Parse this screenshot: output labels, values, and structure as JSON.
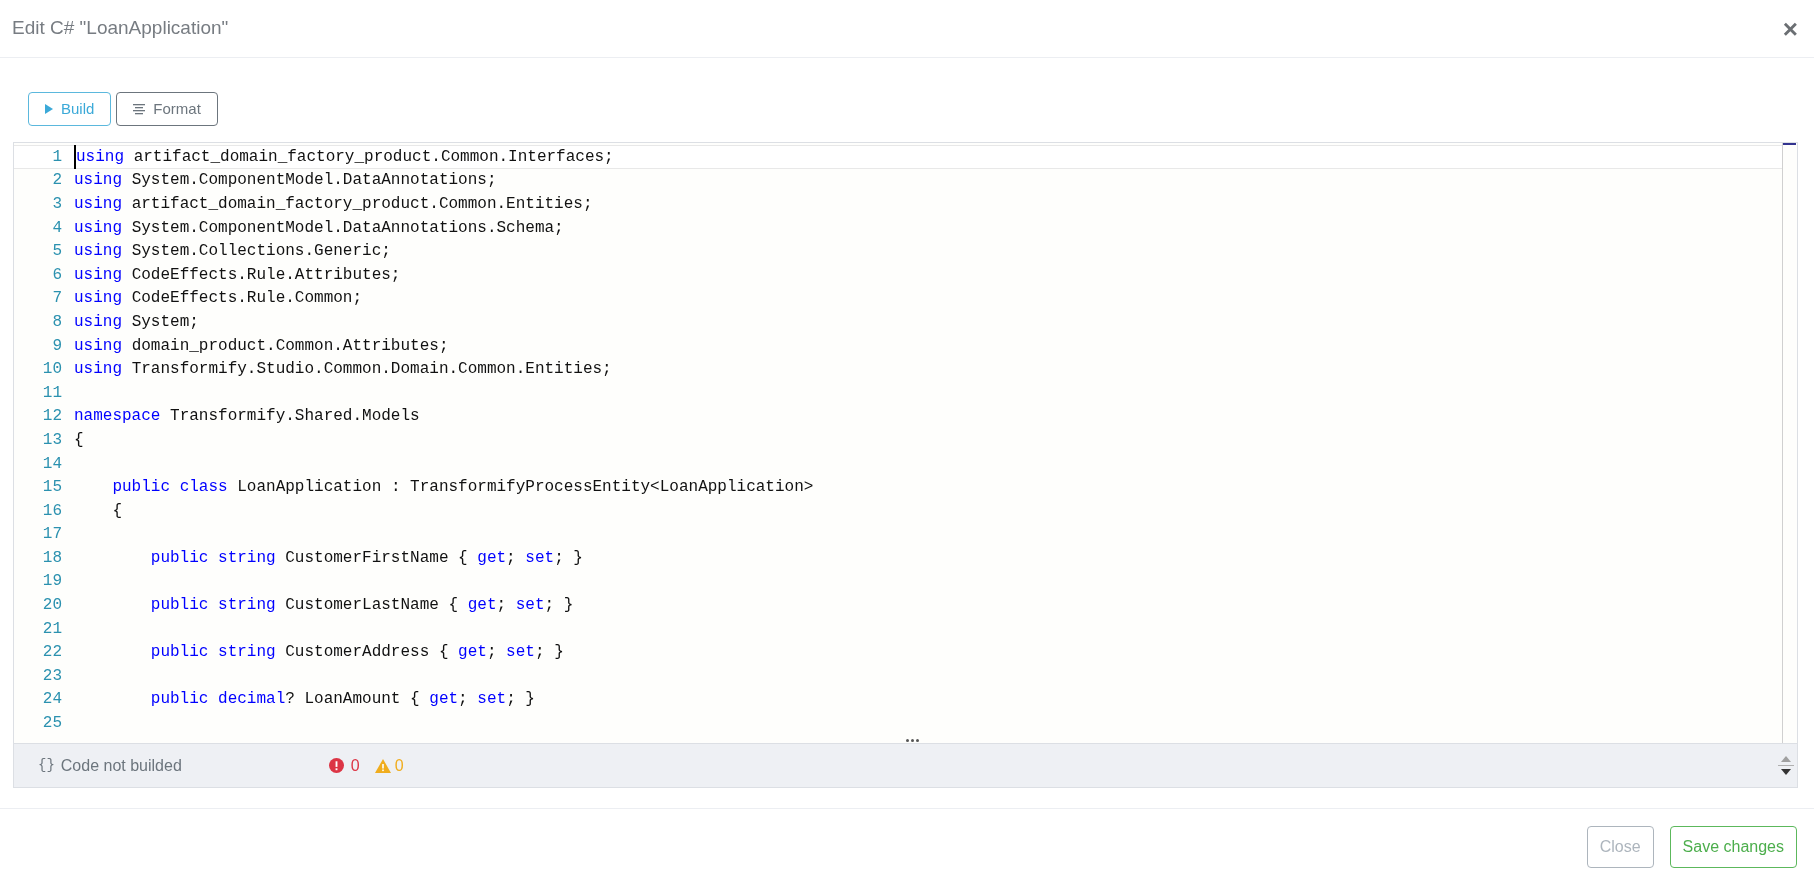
{
  "dialog": {
    "title": "Edit C# \"LoanApplication\"",
    "close_icon": "×"
  },
  "toolbar": [
    {
      "kind": "build",
      "label": "Build"
    },
    {
      "kind": "format",
      "label": "Format"
    }
  ],
  "editor": {
    "lines": [
      {
        "number": "1",
        "current": true,
        "tokens": [
          {
            "kind": "keyword",
            "text": "using"
          },
          {
            "kind": "plain",
            "text": " artifact_domain_factory_product.Common.Interfaces;"
          }
        ]
      },
      {
        "number": "2",
        "current": false,
        "tokens": [
          {
            "kind": "keyword",
            "text": "using"
          },
          {
            "kind": "plain",
            "text": " System.ComponentModel.DataAnnotations;"
          }
        ]
      },
      {
        "number": "3",
        "current": false,
        "tokens": [
          {
            "kind": "keyword",
            "text": "using"
          },
          {
            "kind": "plain",
            "text": " artifact_domain_factory_product.Common.Entities;"
          }
        ]
      },
      {
        "number": "4",
        "current": false,
        "tokens": [
          {
            "kind": "keyword",
            "text": "using"
          },
          {
            "kind": "plain",
            "text": " System.ComponentModel.DataAnnotations.Schema;"
          }
        ]
      },
      {
        "number": "5",
        "current": false,
        "tokens": [
          {
            "kind": "keyword",
            "text": "using"
          },
          {
            "kind": "plain",
            "text": " System.Collections.Generic;"
          }
        ]
      },
      {
        "number": "6",
        "current": false,
        "tokens": [
          {
            "kind": "keyword",
            "text": "using"
          },
          {
            "kind": "plain",
            "text": " CodeEffects.Rule.Attributes;"
          }
        ]
      },
      {
        "number": "7",
        "current": false,
        "tokens": [
          {
            "kind": "keyword",
            "text": "using"
          },
          {
            "kind": "plain",
            "text": " CodeEffects.Rule.Common;"
          }
        ]
      },
      {
        "number": "8",
        "current": false,
        "tokens": [
          {
            "kind": "keyword",
            "text": "using"
          },
          {
            "kind": "plain",
            "text": " System;"
          }
        ]
      },
      {
        "number": "9",
        "current": false,
        "tokens": [
          {
            "kind": "keyword",
            "text": "using"
          },
          {
            "kind": "plain",
            "text": " domain_product.Common.Attributes;"
          }
        ]
      },
      {
        "number": "10",
        "current": false,
        "tokens": [
          {
            "kind": "keyword",
            "text": "using"
          },
          {
            "kind": "plain",
            "text": " Transformify.Studio.Common.Domain.Common.Entities;"
          }
        ]
      },
      {
        "number": "11",
        "current": false
      },
      {
        "number": "12",
        "current": false,
        "tokens": [
          {
            "kind": "keyword",
            "text": "namespace"
          },
          {
            "kind": "plain",
            "text": " Transformify.Shared.Models"
          }
        ]
      },
      {
        "number": "13",
        "current": false,
        "tokens": [
          {
            "kind": "plain",
            "text": "{"
          }
        ]
      },
      {
        "number": "14",
        "current": false
      },
      {
        "number": "15",
        "current": false,
        "tokens": [
          {
            "kind": "keyword",
            "text": "    public"
          },
          {
            "kind": "keyword",
            "text": " class"
          },
          {
            "kind": "plain",
            "text": " LoanApplication : TransformifyProcessEntity<LoanApplication>"
          }
        ]
      },
      {
        "number": "16",
        "current": false,
        "tokens": [
          {
            "kind": "plain",
            "text": "    {"
          }
        ]
      },
      {
        "number": "17",
        "current": false
      },
      {
        "number": "18",
        "current": false,
        "tokens": [
          {
            "kind": "keyword",
            "text": "        public"
          },
          {
            "kind": "keyword",
            "text": " string"
          },
          {
            "kind": "plain",
            "text": " CustomerFirstName { "
          },
          {
            "kind": "keyword",
            "text": "get"
          },
          {
            "kind": "plain",
            "text": ";"
          },
          {
            "kind": "keyword",
            "text": " set"
          },
          {
            "kind": "plain",
            "text": "; }"
          }
        ]
      },
      {
        "number": "19",
        "current": false
      },
      {
        "number": "20",
        "current": false,
        "tokens": [
          {
            "kind": "keyword",
            "text": "        public"
          },
          {
            "kind": "keyword",
            "text": " string"
          },
          {
            "kind": "plain",
            "text": " CustomerLastName { "
          },
          {
            "kind": "keyword",
            "text": "get"
          },
          {
            "kind": "plain",
            "text": ";"
          },
          {
            "kind": "keyword",
            "text": " set"
          },
          {
            "kind": "plain",
            "text": "; }"
          }
        ]
      },
      {
        "number": "21",
        "current": false
      },
      {
        "number": "22",
        "current": false,
        "tokens": [
          {
            "kind": "keyword",
            "text": "        public"
          },
          {
            "kind": "keyword",
            "text": " string"
          },
          {
            "kind": "plain",
            "text": " CustomerAddress { "
          },
          {
            "kind": "keyword",
            "text": "get"
          },
          {
            "kind": "plain",
            "text": ";"
          },
          {
            "kind": "keyword",
            "text": " set"
          },
          {
            "kind": "plain",
            "text": "; }"
          }
        ]
      },
      {
        "number": "23",
        "current": false
      },
      {
        "number": "24",
        "current": false,
        "tokens": [
          {
            "kind": "keyword",
            "text": "        public"
          },
          {
            "kind": "keyword",
            "text": " decimal"
          },
          {
            "kind": "plain",
            "text": "? LoanAmount { "
          },
          {
            "kind": "keyword",
            "text": "get"
          },
          {
            "kind": "plain",
            "text": ";"
          },
          {
            "kind": "keyword",
            "text": " set"
          },
          {
            "kind": "plain",
            "text": "; }"
          }
        ]
      },
      {
        "number": "25",
        "current": false
      }
    ]
  },
  "status_bar": {
    "icon": "{}",
    "message": "Code not builded",
    "errors": "0",
    "warnings": "0"
  },
  "footer": [
    {
      "kind": "secondary",
      "label": "Close"
    },
    {
      "kind": "primary",
      "label": "Save changes"
    }
  ]
}
